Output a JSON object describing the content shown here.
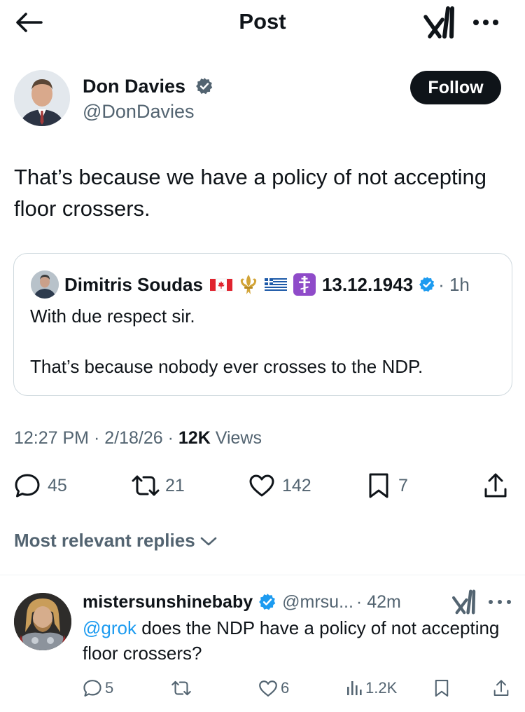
{
  "header": {
    "title": "Post",
    "back_icon": "arrow-left-icon",
    "grok_icon": "grok-icon",
    "more_icon": "more-horizontal-icon"
  },
  "post": {
    "author": {
      "name": "Don Davies",
      "handle": "@DonDavies",
      "verified": true
    },
    "follow_label": "Follow",
    "text": "That’s because we have a policy of not accepting floor crossers.",
    "quote": {
      "author_name": "Dimitris Soudas",
      "name_suffix": "13.12.1943",
      "flair_icons": [
        "canada-flag-icon",
        "fleur-de-lis-icon",
        "greece-flag-icon",
        "orthodox-cross-icon"
      ],
      "verified": true,
      "time": "· 1h",
      "lines": [
        "With due respect sir.",
        "That’s because nobody ever crosses to the NDP."
      ]
    },
    "meta": {
      "time": "12:27 PM",
      "sep1": "·",
      "date": "2/18/26",
      "sep2": "·",
      "views_count": "12K",
      "views_label": "Views"
    },
    "actions": {
      "replies": "45",
      "reposts": "21",
      "likes": "142",
      "bookmarks": "7"
    }
  },
  "replies_filter": {
    "label": "Most relevant replies"
  },
  "reply": {
    "author_name": "mistersunshinebaby",
    "verified": true,
    "handle": "@mrsu...",
    "time": "· 42m",
    "mention": "@grok",
    "text": " does the NDP have a policy of not accepting floor crossers?",
    "actions": {
      "replies": "5",
      "reposts": "",
      "likes": "6",
      "views": "1.2K"
    }
  },
  "colors": {
    "text": "#0f1419",
    "secondary": "#536471",
    "verified_blue": "#1d9bf0",
    "border": "#cfd9de"
  }
}
